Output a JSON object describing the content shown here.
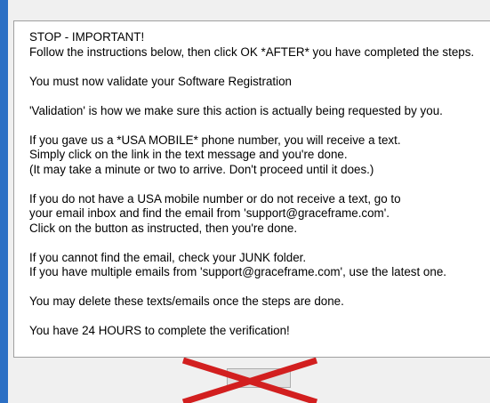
{
  "message": {
    "lines": [
      "STOP - IMPORTANT!",
      "Follow the instructions below, then click OK *AFTER* you have completed the steps.",
      "",
      "You must now validate your Software Registration",
      "",
      "'Validation' is how we make sure this action is actually being requested by you.",
      "",
      "If you gave us a *USA MOBILE* phone number, you will receive a text.",
      "Simply click on the link in the text message and you're done.",
      "(It may take a minute or two to arrive. Don't proceed until it does.)",
      "",
      "If you do not have a USA mobile number or do not receive a text, go to",
      "your email inbox and find the email from 'support@graceframe.com'.",
      "Click on the button as instructed, then you're done.",
      "",
      "If you cannot find the email, check your JUNK folder.",
      "If you have multiple emails from 'support@graceframe.com', use the latest one.",
      "",
      "You may delete these texts/emails once the steps are done.",
      "",
      "You have 24 HOURS to complete the verification!"
    ]
  },
  "ok_button": {
    "label": ""
  },
  "colors": {
    "window_edge": "#2b6fc4",
    "cross": "#d21f1f",
    "dialog_bg": "#f0f0f0"
  }
}
